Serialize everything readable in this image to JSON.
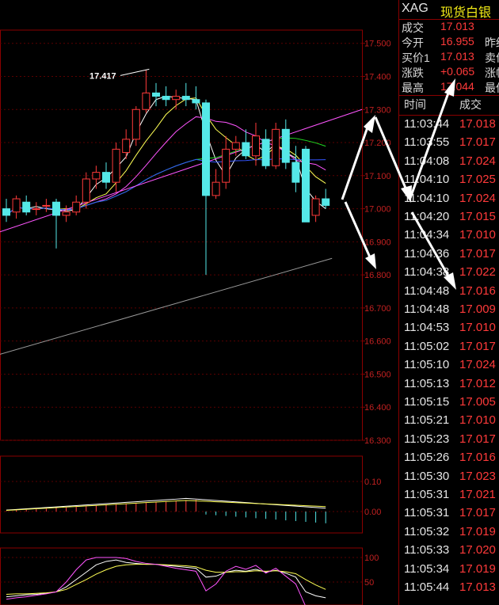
{
  "header": {
    "symbol": "XAG",
    "name": "现货白银"
  },
  "quote": [
    {
      "label": "成交",
      "value": "17.013",
      "label2": ""
    },
    {
      "label": "今开",
      "value": "16.955",
      "label2": "昨结"
    },
    {
      "label": "买价1",
      "value": "17.013",
      "label2": "卖价"
    },
    {
      "label": "涨跌",
      "value": "+0.065",
      "label2": "涨幅"
    },
    {
      "label": "最高",
      "value": "17.044",
      "label2": "最低"
    }
  ],
  "ticks_header": {
    "time": "时间",
    "price": "成交"
  },
  "ticks": [
    {
      "time": "11:03:44",
      "price": "17.018"
    },
    {
      "time": "11:03:55",
      "price": "17.017"
    },
    {
      "time": "11:04:08",
      "price": "17.024"
    },
    {
      "time": "11:04:10",
      "price": "17.025"
    },
    {
      "time": "11:04:10",
      "price": "17.024"
    },
    {
      "time": "11:04:20",
      "price": "17.015"
    },
    {
      "time": "11:04:34",
      "price": "17.010"
    },
    {
      "time": "11:04:36",
      "price": "17.017"
    },
    {
      "time": "11:04:38",
      "price": "17.022"
    },
    {
      "time": "11:04:48",
      "price": "17.016"
    },
    {
      "time": "11:04:48",
      "price": "17.009"
    },
    {
      "time": "11:04:53",
      "price": "17.010"
    },
    {
      "time": "11:05:02",
      "price": "17.017"
    },
    {
      "time": "11:05:10",
      "price": "17.024"
    },
    {
      "time": "11:05:13",
      "price": "17.012"
    },
    {
      "time": "11:05:15",
      "price": "17.005"
    },
    {
      "time": "11:05:21",
      "price": "17.010"
    },
    {
      "time": "11:05:23",
      "price": "17.017"
    },
    {
      "time": "11:05:26",
      "price": "17.016"
    },
    {
      "time": "11:05:30",
      "price": "17.023"
    },
    {
      "time": "11:05:31",
      "price": "17.021"
    },
    {
      "time": "11:05:31",
      "price": "17.017"
    },
    {
      "time": "11:05:32",
      "price": "17.019"
    },
    {
      "time": "11:05:33",
      "price": "17.020"
    },
    {
      "time": "11:05:34",
      "price": "17.019"
    },
    {
      "time": "11:05:44",
      "price": "17.013"
    }
  ],
  "chart_data": {
    "type": "candlestick",
    "price_axis": {
      "ticks": [
        "17.500",
        "17.400",
        "17.300",
        "17.200",
        "17.100",
        "17.000",
        "16.900",
        "16.800",
        "16.700",
        "16.600",
        "16.500",
        "16.400",
        "16.300"
      ],
      "ylim": [
        16.3,
        17.54
      ]
    },
    "annotation": {
      "text": "17.417",
      "value": 17.417
    },
    "colors": {
      "up": "#ff3a3a",
      "down": "#55e8e8",
      "ma1": "#ffffff",
      "ma2": "#ffff55",
      "ma3": "#ff55ff",
      "ma4": "#22dd22",
      "ma5": "#3355ff",
      "ma6": "#999999",
      "trend": "#ff55ff"
    },
    "candles": [
      {
        "o": 17.0,
        "h": 17.03,
        "l": 16.96,
        "c": 16.98
      },
      {
        "o": 16.99,
        "h": 17.04,
        "l": 16.97,
        "c": 17.03
      },
      {
        "o": 17.02,
        "h": 17.04,
        "l": 16.98,
        "c": 16.99
      },
      {
        "o": 17.0,
        "h": 17.02,
        "l": 16.98,
        "c": 17.0
      },
      {
        "o": 17.01,
        "h": 17.03,
        "l": 16.99,
        "c": 17.01
      },
      {
        "o": 17.02,
        "h": 17.03,
        "l": 16.88,
        "c": 16.98
      },
      {
        "o": 16.98,
        "h": 17.01,
        "l": 16.96,
        "c": 16.99
      },
      {
        "o": 16.99,
        "h": 17.04,
        "l": 16.98,
        "c": 17.02
      },
      {
        "o": 17.02,
        "h": 17.11,
        "l": 17.0,
        "c": 17.09
      },
      {
        "o": 17.09,
        "h": 17.13,
        "l": 17.06,
        "c": 17.11
      },
      {
        "o": 17.11,
        "h": 17.14,
        "l": 17.06,
        "c": 17.08
      },
      {
        "o": 17.08,
        "h": 17.2,
        "l": 17.05,
        "c": 17.18
      },
      {
        "o": 17.17,
        "h": 17.24,
        "l": 17.15,
        "c": 17.21
      },
      {
        "o": 17.21,
        "h": 17.31,
        "l": 17.19,
        "c": 17.3
      },
      {
        "o": 17.3,
        "h": 17.42,
        "l": 17.29,
        "c": 17.35
      },
      {
        "o": 17.35,
        "h": 17.38,
        "l": 17.31,
        "c": 17.34
      },
      {
        "o": 17.34,
        "h": 17.37,
        "l": 17.31,
        "c": 17.33
      },
      {
        "o": 17.33,
        "h": 17.36,
        "l": 17.3,
        "c": 17.34
      },
      {
        "o": 17.34,
        "h": 17.38,
        "l": 17.31,
        "c": 17.33
      },
      {
        "o": 17.33,
        "h": 17.37,
        "l": 17.3,
        "c": 17.32
      },
      {
        "o": 17.32,
        "h": 17.33,
        "l": 16.8,
        "c": 17.04
      },
      {
        "o": 17.04,
        "h": 17.12,
        "l": 17.03,
        "c": 17.08
      },
      {
        "o": 17.08,
        "h": 17.22,
        "l": 17.06,
        "c": 17.18
      },
      {
        "o": 17.18,
        "h": 17.22,
        "l": 17.16,
        "c": 17.2
      },
      {
        "o": 17.2,
        "h": 17.24,
        "l": 17.15,
        "c": 17.16
      },
      {
        "o": 17.16,
        "h": 17.26,
        "l": 17.13,
        "c": 17.22
      },
      {
        "o": 17.21,
        "h": 17.24,
        "l": 17.12,
        "c": 17.13
      },
      {
        "o": 17.13,
        "h": 17.26,
        "l": 17.12,
        "c": 17.24
      },
      {
        "o": 17.24,
        "h": 17.27,
        "l": 17.12,
        "c": 17.14
      },
      {
        "o": 17.14,
        "h": 17.19,
        "l": 17.05,
        "c": 17.08
      },
      {
        "o": 17.18,
        "h": 17.19,
        "l": 16.96,
        "c": 16.96
      },
      {
        "o": 16.98,
        "h": 17.04,
        "l": 16.96,
        "c": 17.03
      },
      {
        "o": 17.03,
        "h": 17.06,
        "l": 17.0,
        "c": 17.01
      }
    ],
    "macd": {
      "ylim": [
        -0.05,
        0.14
      ],
      "ticks": [
        "0.10",
        "0.00"
      ]
    },
    "kdj": {
      "ticks": [
        "100",
        "50"
      ]
    }
  }
}
